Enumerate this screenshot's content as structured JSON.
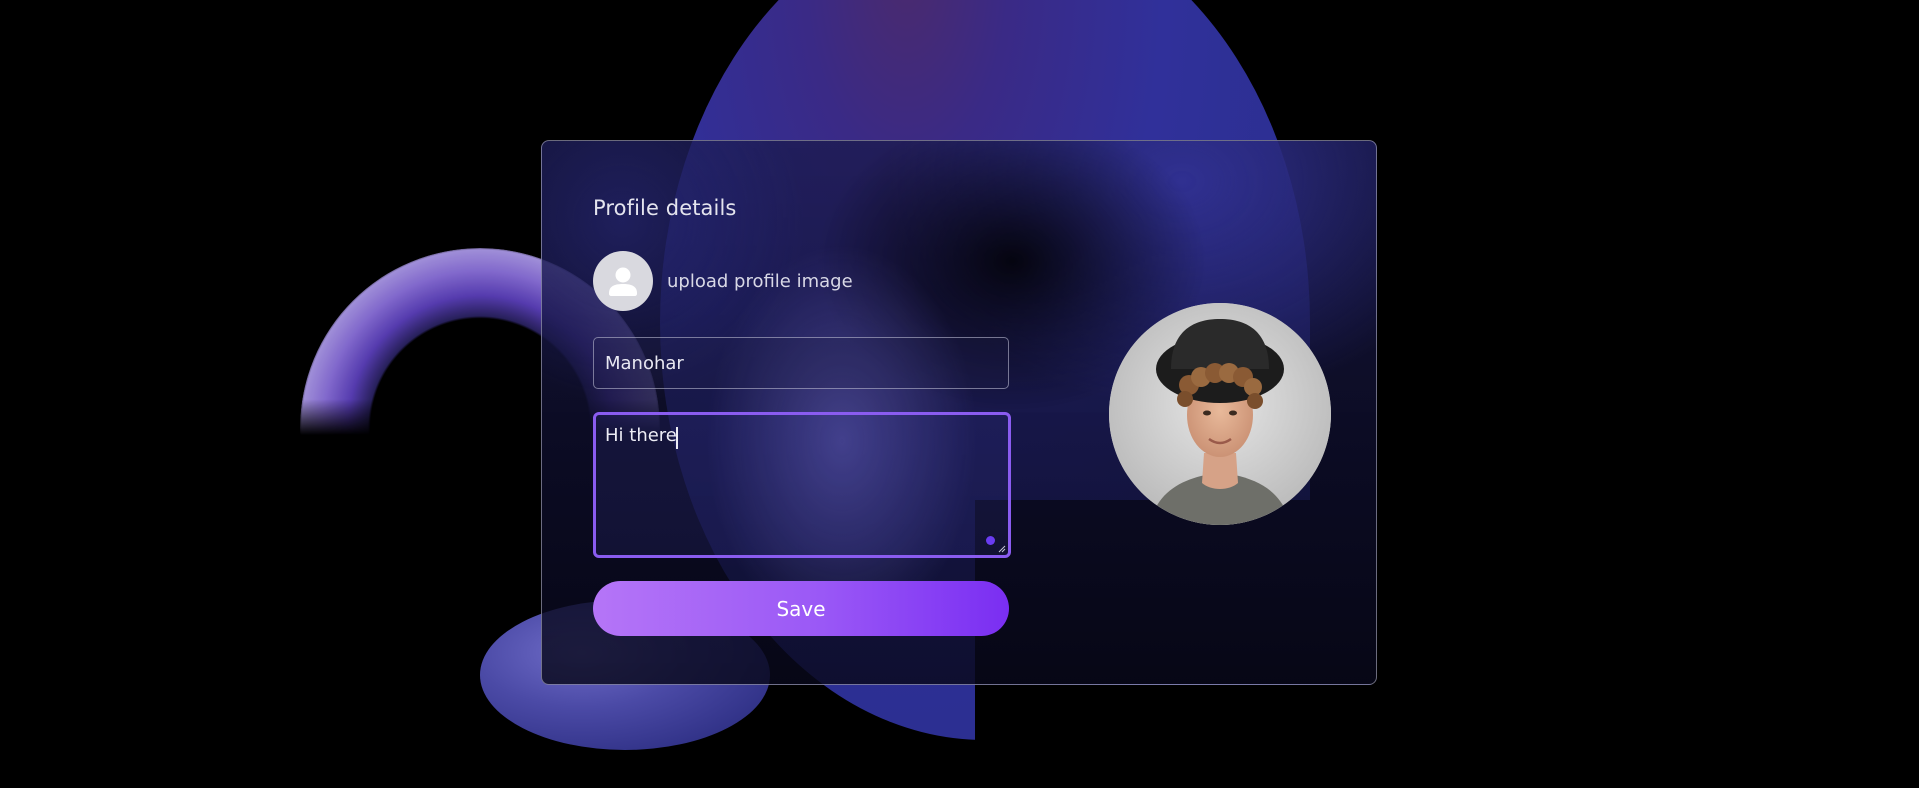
{
  "card": {
    "title": "Profile details"
  },
  "upload": {
    "label": "upload profile image",
    "icon": "user-silhouette-icon"
  },
  "form": {
    "name_value": "Manohar",
    "bio_value": "Hi there"
  },
  "save_button": {
    "label": "Save"
  },
  "colors": {
    "accent": "#8a5cf0",
    "button_gradient_start": "#b575f7",
    "button_gradient_end": "#7a2ef2",
    "background": "#000000",
    "status_dot": "#6a3cf2"
  }
}
